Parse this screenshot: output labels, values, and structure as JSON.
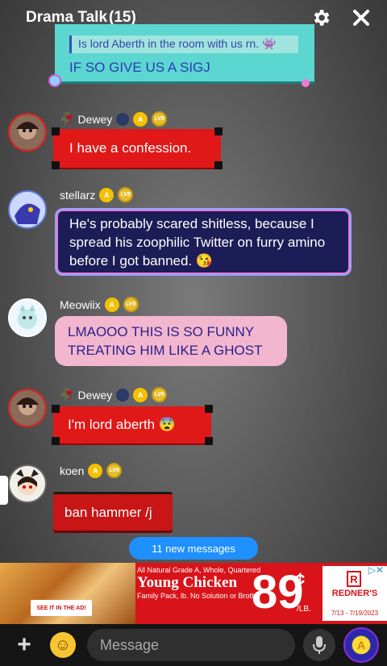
{
  "header": {
    "title": "Drama Talk",
    "member_count": "(15)"
  },
  "top_message": {
    "quote": "Is lord Aberth in the room with us rn. 👾",
    "text": "IF SO GIVE US A SIGJ"
  },
  "messages": [
    {
      "user": "Dewey",
      "text": "I have a confession.",
      "level": "LV9"
    },
    {
      "user": "stellarz",
      "text": "He's probably scared shitless, because I spread his zoophilic Twitter on furry amino before I got banned. 😘",
      "level": "LV8"
    },
    {
      "user": "Meowiix",
      "text": "LMAOOO THIS IS SO FUNNY TREATING HIM LIKE A GHOST",
      "level": "LV9"
    },
    {
      "user": "Dewey",
      "text": "I'm lord aberth 😨",
      "level": "LV9"
    },
    {
      "user": "koen",
      "text": "ban hammer /j",
      "level": "LV8"
    }
  ],
  "new_messages_label": "11 new messages",
  "ad": {
    "line1": "All Natural Grade A, Whole, Quartered",
    "line2": "Young Chicken",
    "line3": "Family Pack, lb. No Solution or Broth",
    "price_dollars": "89",
    "price_cents": "¢",
    "price_unit": "/LB.",
    "see_label": "SEE IT IN THE AD!",
    "logo_letter": "R",
    "store_name": "REDNER'S",
    "dates": "7/13 - 7/19/2023"
  },
  "input": {
    "placeholder": "Message"
  },
  "colors": {
    "accent": "#1e90ff",
    "red_bubble": "#e01818",
    "navy_bubble": "#1c1c56",
    "pink_bubble": "#f2b7cf"
  }
}
